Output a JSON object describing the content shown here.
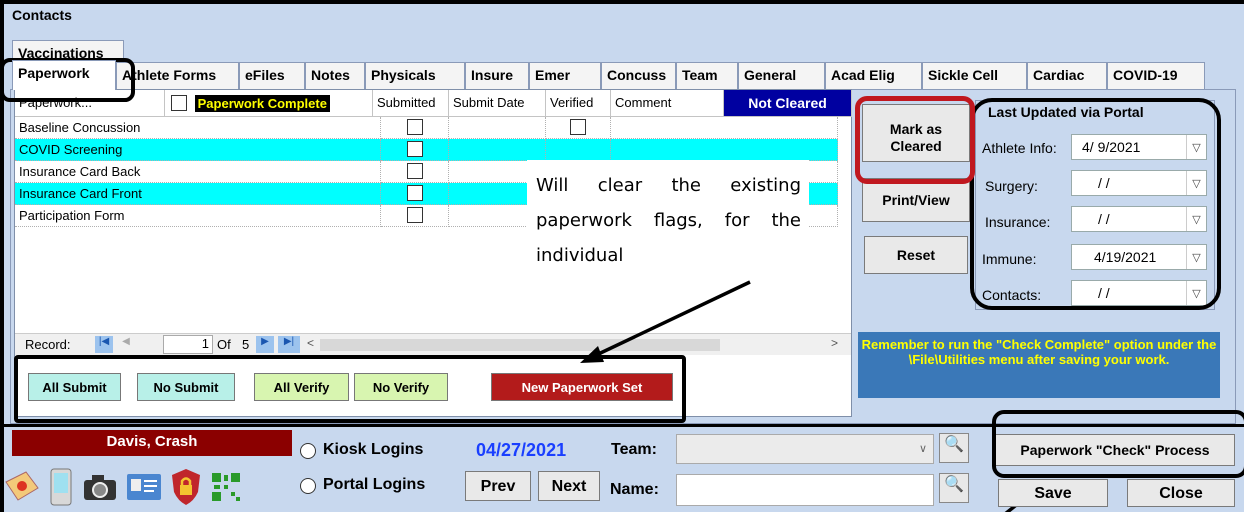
{
  "window": {
    "title": "Contacts"
  },
  "tabs_row0": [
    {
      "label": "Vaccinations"
    }
  ],
  "tabs": [
    {
      "label": "Paperwork"
    },
    {
      "label": "Athlete Forms"
    },
    {
      "label": "eFiles"
    },
    {
      "label": "Notes"
    },
    {
      "label": "Physicals"
    },
    {
      "label": "Insure"
    },
    {
      "label": "Emer"
    },
    {
      "label": "Concuss"
    },
    {
      "label": "Team"
    },
    {
      "label": "General"
    },
    {
      "label": "Acad Elig"
    },
    {
      "label": "Sickle Cell"
    },
    {
      "label": "Cardiac"
    },
    {
      "label": "COVID-19"
    }
  ],
  "grid": {
    "columns": {
      "paperwork": "Paperwork...",
      "complete": "Paperwork Complete",
      "submitted": "Submitted",
      "submit_date": "Submit Date",
      "verified": "Verified",
      "comment": "Comment",
      "status": "Not Cleared"
    },
    "rows": [
      {
        "name": "Baseline Concussion"
      },
      {
        "name": "COVID Screening"
      },
      {
        "name": "Insurance Card Back"
      },
      {
        "name": "Insurance Card Front"
      },
      {
        "name": "Participation Form"
      }
    ],
    "nav": {
      "record_label": "Record:",
      "current": "1",
      "of_label": "Of",
      "total": "5"
    }
  },
  "note": {
    "text": "Will clear the existing paperwork flags, for the individual"
  },
  "actions": {
    "all_submit": "All Submit",
    "no_submit": "No Submit",
    "all_verify": "All Verify",
    "no_verify": "No Verify",
    "new_set": "New Paperwork Set"
  },
  "side_buttons": {
    "mark_cleared": "Mark as Cleared",
    "print_view": "Print/View",
    "reset": "Reset"
  },
  "portal": {
    "title": "Last Updated via Portal",
    "fields": [
      {
        "label": "Athlete Info:",
        "value": "4/ 9/2021"
      },
      {
        "label": "Surgery:",
        "value": "/  /"
      },
      {
        "label": "Insurance:",
        "value": "/  /"
      },
      {
        "label": "Immune:",
        "value": "4/19/2021"
      },
      {
        "label": "Contacts:",
        "value": "/  /"
      }
    ]
  },
  "reminder": {
    "text": "Remember to run the \"Check Complete\" option under the \\File\\Utilities menu after saving your work."
  },
  "bottom": {
    "person": "Davis, Crash",
    "kiosk": "Kiosk Logins",
    "portal": "Portal Logins",
    "date": "04/27/2021",
    "prev": "Prev",
    "next": "Next",
    "team_label": "Team:",
    "team_value": "",
    "name_label": "Name:",
    "name_value": "",
    "check_process": "Paperwork \"Check\" Process",
    "save": "Save",
    "close": "Close"
  },
  "colors": {
    "bg": "#c8d8ee",
    "cyan": "#00ffff",
    "dark_red": "#8b0000",
    "navy": "#0000a0",
    "blue_date": "#1a3fff",
    "reminder_bg": "#3a78b8"
  }
}
